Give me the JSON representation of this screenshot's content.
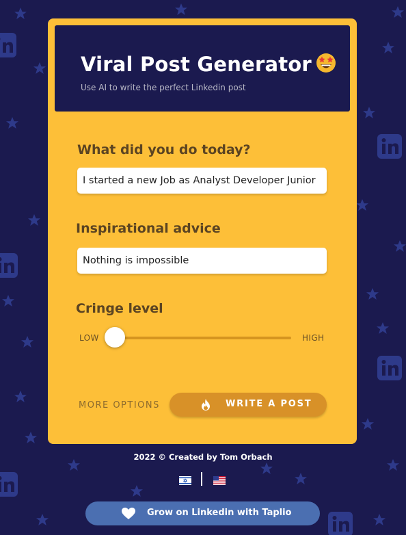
{
  "header": {
    "title": "Viral Post Generator",
    "title_emoji": "star-struck-emoji",
    "subtitle": "Use AI to write the perfect Linkedin post"
  },
  "form": {
    "today_label": "What did you do today?",
    "today_value": "I started a new Job as Analyst Developer Junior",
    "advice_label": "Inspirational advice",
    "advice_value": "Nothing is impossible",
    "cringe_label": "Cringe level",
    "cringe_low_label": "LOW",
    "cringe_high_label": "HIGH",
    "cringe_level": 0,
    "more_options_label": "MORE OPTIONS",
    "write_button_label": "WRITE A POST",
    "write_button_icon": "fire-icon"
  },
  "footer": {
    "credit": "2022 © Created by Tom Orbach",
    "flags": [
      "israel-flag-icon",
      "us-flag-icon"
    ],
    "taplio_label": "Grow on Linkedin with Taplio",
    "taplio_icon": "heart-icon"
  },
  "colors": {
    "background": "#1b1a4f",
    "card": "#fdbf38",
    "header": "#1b1a4f",
    "label_text": "#5b4422",
    "write_button": "#d89128",
    "taplio_button": "#4b6fb1",
    "decor_pattern": "#2e3a8a"
  }
}
